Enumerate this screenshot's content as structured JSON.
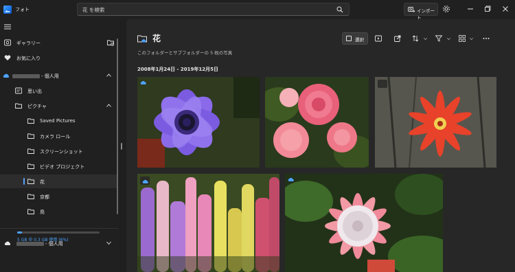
{
  "app": {
    "title": "フォト"
  },
  "search": {
    "value": "花 を検索"
  },
  "header": {
    "import_label": "インポート"
  },
  "sidebar": {
    "gallery": "ギャラリー",
    "favorites": "お気に入り",
    "onedrive_personal_suffix": "- 個人用",
    "memories": "思い出",
    "pictures": "ピクチャ",
    "folders": [
      "Saved Pictures",
      "カメラ ロール",
      "スクリーンショット",
      "ビデオ プロジェクト",
      "花",
      "京都",
      "鳥"
    ],
    "selected_folder": "花",
    "cloud_account_suffix": "- 個人用",
    "storage_text": "5 GB 中 0.3 GB 使用 (6%)",
    "storage_fraction": 0.06
  },
  "main": {
    "title": "花",
    "subtitle": "このフォルダーとサブフォルダーの 5 枚の写真",
    "date_range": "2008年1月24日 - 2019年12月5日",
    "select_label": "選択"
  },
  "colors": {
    "accent": "#4da3ff",
    "background": "#1f1f1f",
    "panel": "#272727"
  },
  "photos": [
    {
      "name": "purple-anemone",
      "badge": "cloud"
    },
    {
      "name": "pink-roses",
      "badge": "none"
    },
    {
      "name": "red-passion-flower",
      "badge": "dark"
    },
    {
      "name": "lupine-field",
      "badge": "dark-cloud"
    },
    {
      "name": "protea",
      "badge": "cloud"
    }
  ]
}
